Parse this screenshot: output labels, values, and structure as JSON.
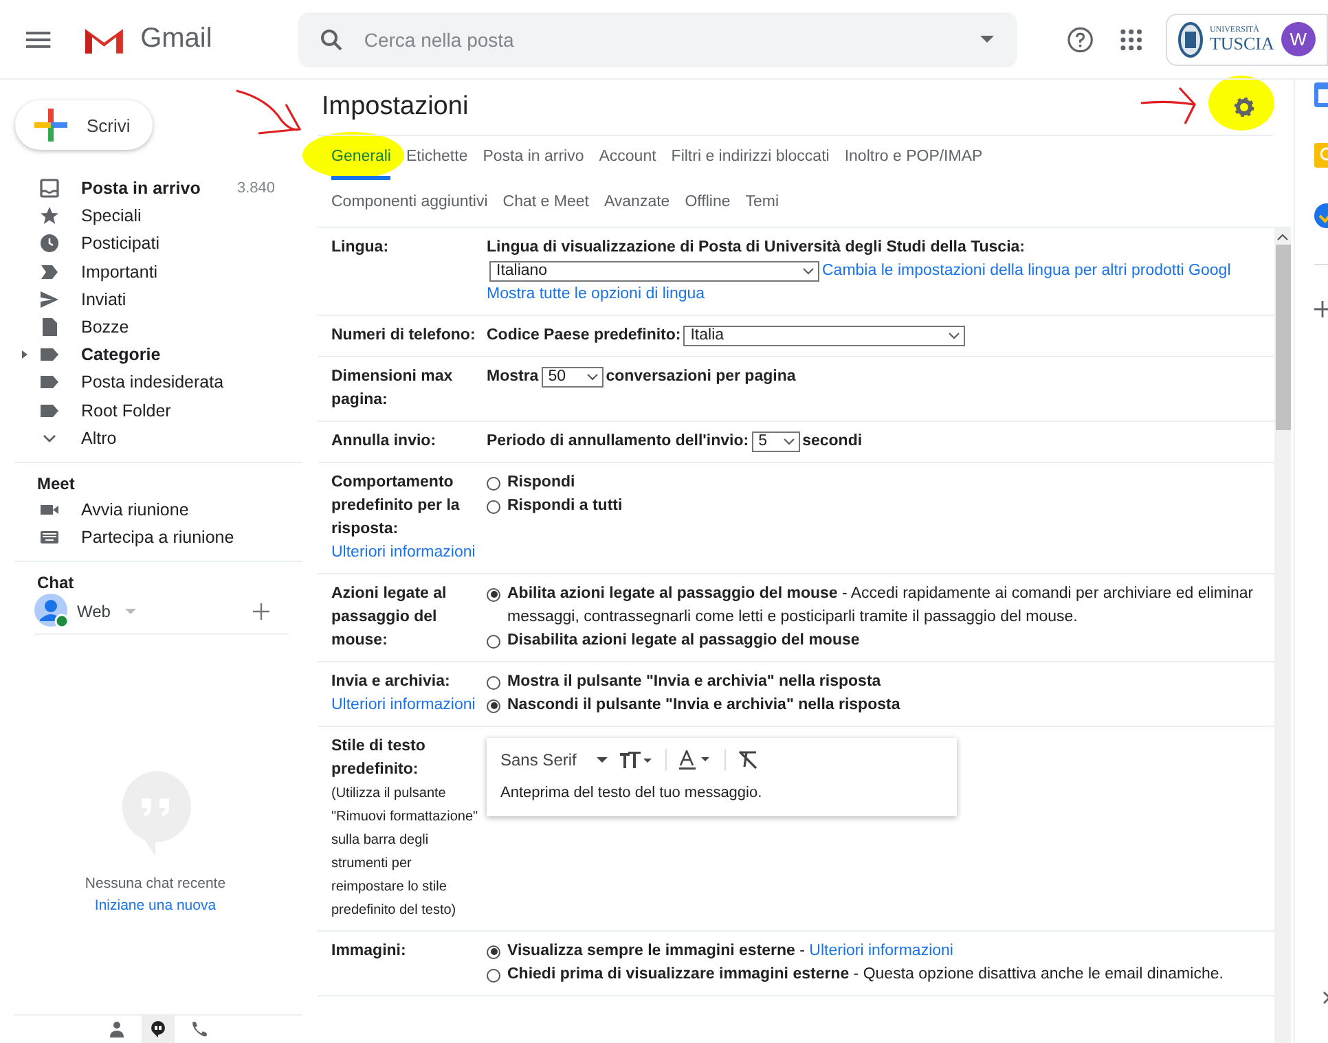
{
  "header": {
    "app_name": "Gmail",
    "search_placeholder": "Cerca nella posta",
    "org_logo": [
      "UNIVERSITÀ",
      "TUSCIA"
    ],
    "avatar": "W"
  },
  "sidebar": {
    "compose": "Scrivi",
    "items": [
      {
        "label": "Posta in arrivo",
        "kind": "inbox",
        "bold": true,
        "count": "3.840"
      },
      {
        "label": "Speciali",
        "kind": "star",
        "bold": false
      },
      {
        "label": "Posticipati",
        "kind": "clock",
        "bold": false
      },
      {
        "label": "Importanti",
        "kind": "important",
        "bold": false
      },
      {
        "label": "Inviati",
        "kind": "send",
        "bold": false
      },
      {
        "label": "Bozze",
        "kind": "draft",
        "bold": false
      },
      {
        "label": "Categorie",
        "kind": "label",
        "bold": true,
        "expandable": true
      },
      {
        "label": "Posta indesiderata",
        "kind": "label",
        "bold": false
      },
      {
        "label": "Root Folder",
        "kind": "label",
        "bold": false
      },
      {
        "label": "Altro",
        "kind": "chevron",
        "bold": false
      }
    ],
    "meet": {
      "title": "Meet",
      "items": [
        {
          "label": "Avvia riunione",
          "kind": "video"
        },
        {
          "label": "Partecipa a riunione",
          "kind": "keyboard"
        }
      ]
    },
    "chat": {
      "title": "Chat",
      "user": "Web",
      "empty": "Nessuna chat recente",
      "link": "Iniziane una nuova"
    }
  },
  "settings": {
    "title": "Impostazioni",
    "tabs": [
      [
        {
          "label": "Generali",
          "selected": true
        },
        {
          "label": "Etichette",
          "selected": false
        },
        {
          "label": "Posta in arrivo",
          "selected": false
        },
        {
          "label": "Account",
          "selected": false
        },
        {
          "label": "Filtri e indirizzi bloccati",
          "selected": false
        },
        {
          "label": "Inoltro e POP/IMAP",
          "selected": false
        }
      ],
      [
        {
          "label": "Componenti aggiuntivi",
          "selected": false
        },
        {
          "label": "Chat e Meet",
          "selected": false
        },
        {
          "label": "Avanzate",
          "selected": false
        },
        {
          "label": "Offline",
          "selected": false
        },
        {
          "label": "Temi",
          "selected": false
        }
      ]
    ],
    "rows": [
      {
        "label": "Lingua:",
        "lines": [
          {
            "kind": "plain",
            "parts": [
              {
                "kind": "text",
                "bold": true,
                "text": "Lingua di visualizzazione di Posta di Università degli Studi della Tuscia:"
              }
            ]
          },
          {
            "kind": "plain",
            "parts": [
              {
                "kind": "select",
                "value": "Italiano"
              },
              {
                "kind": "link",
                "text": "Cambia le impostazioni della lingua per altri prodotti Googl"
              }
            ]
          },
          {
            "kind": "plain",
            "parts": [
              {
                "kind": "link",
                "text": "Mostra tutte le opzioni di lingua"
              }
            ]
          }
        ]
      },
      {
        "label": "Numeri di telefono:",
        "lines": [
          {
            "kind": "plain",
            "parts": [
              {
                "kind": "text",
                "bold": true,
                "text": "Codice Paese predefinito:"
              },
              {
                "kind": "select",
                "value": "Italia"
              }
            ]
          }
        ]
      },
      {
        "label": "Dimensioni max pagina:",
        "lines": [
          {
            "kind": "plain",
            "parts": [
              {
                "kind": "text",
                "bold": true,
                "text": "Mostra"
              },
              {
                "kind": "select",
                "value": "50"
              },
              {
                "kind": "text",
                "bold": true,
                "text": "conversazioni per pagina"
              }
            ]
          }
        ]
      },
      {
        "label": "Annulla invio:",
        "lines": [
          {
            "kind": "plain",
            "parts": [
              {
                "kind": "text",
                "bold": true,
                "text": "Periodo di annullamento dell'invio:"
              },
              {
                "kind": "select",
                "value": "5"
              },
              {
                "kind": "text",
                "bold": true,
                "text": "secondi"
              }
            ]
          }
        ]
      },
      {
        "label": "Comportamento predefinito per la risposta:",
        "label_link": "Ulteriori informazioni",
        "lines": [
          {
            "kind": "radio",
            "selected": false,
            "parts": [
              {
                "kind": "text",
                "bold": true,
                "text": "Rispondi"
              }
            ]
          },
          {
            "kind": "radio",
            "selected": false,
            "parts": [
              {
                "kind": "text",
                "bold": true,
                "text": "Rispondi a tutti"
              }
            ]
          }
        ]
      },
      {
        "label": "Azioni legate al passaggio del mouse:",
        "lines": [
          {
            "kind": "radio",
            "selected": true,
            "parts": [
              {
                "kind": "text",
                "bold": true,
                "text": "Abilita azioni legate al passaggio del mouse"
              },
              {
                "kind": "text",
                "bold": false,
                "text": " - Accedi rapidamente ai comandi per archiviare ed eliminar"
              }
            ]
          },
          {
            "kind": "continuation",
            "parts": [
              {
                "kind": "text",
                "bold": false,
                "text": "messaggi, contrassegnarli come letti e posticiparli tramite il passaggio del mouse."
              }
            ]
          },
          {
            "kind": "radio",
            "selected": false,
            "parts": [
              {
                "kind": "text",
                "bold": true,
                "text": "Disabilita azioni legate al passaggio del mouse"
              }
            ]
          }
        ]
      },
      {
        "label": "Invia e archivia:",
        "label_link": "Ulteriori informazioni",
        "lines": [
          {
            "kind": "radio",
            "selected": false,
            "parts": [
              {
                "kind": "text",
                "bold": true,
                "text": "Mostra il pulsante \"Invia e archivia\" nella risposta"
              }
            ]
          },
          {
            "kind": "radio",
            "selected": true,
            "parts": [
              {
                "kind": "text",
                "bold": true,
                "text": "Nascondi il pulsante \"Invia e archivia\" nella risposta"
              }
            ]
          }
        ]
      },
      {
        "label": "Stile di testo predefinito:",
        "note": "(Utilizza il pulsante \"Rimuovi formattazione\" sulla barra degli strumenti per reimpostare lo stile predefinito del testo)",
        "lines": [
          {
            "kind": "editor",
            "font": "Sans Serif",
            "preview": "Anteprima del testo del tuo messaggio."
          }
        ]
      },
      {
        "label": "Immagini:",
        "lines": [
          {
            "kind": "radio",
            "selected": true,
            "parts": [
              {
                "kind": "text",
                "bold": true,
                "text": "Visualizza sempre le immagini esterne"
              },
              {
                "kind": "text",
                "bold": false,
                "text": " - "
              },
              {
                "kind": "link",
                "text": "Ulteriori informazioni"
              }
            ]
          },
          {
            "kind": "radio",
            "selected": false,
            "parts": [
              {
                "kind": "text",
                "bold": true,
                "text": "Chiedi prima di visualizzare immagini esterne"
              },
              {
                "kind": "text",
                "bold": false,
                "text": " - Questa opzione disattiva anche le email dinamiche."
              }
            ]
          }
        ]
      }
    ]
  }
}
